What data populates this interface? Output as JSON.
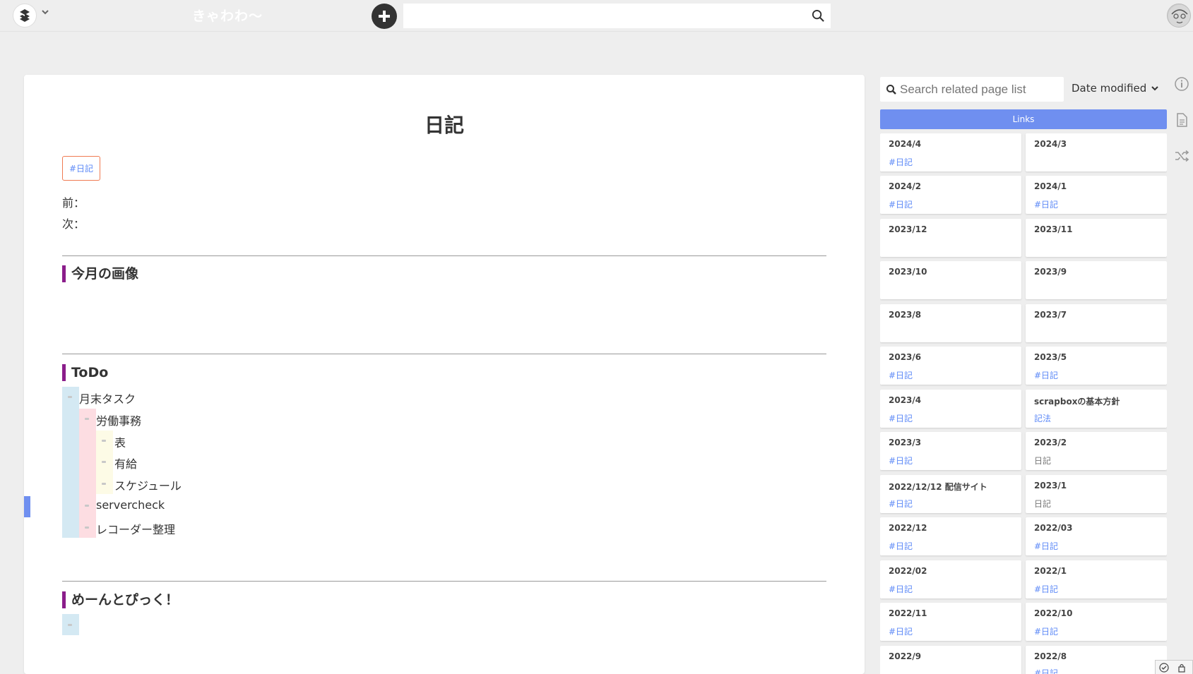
{
  "navbar": {
    "project_title": "きゃわわ〜",
    "search_value": "",
    "search_placeholder": ""
  },
  "page": {
    "title": "日記",
    "tag": "#日記",
    "prev_label": "前：",
    "next_label": "次：",
    "sections": {
      "images": {
        "heading": "今月の画像"
      },
      "todo": {
        "heading": "ToDo",
        "items": [
          {
            "text": "月末タスク",
            "level": 1
          },
          {
            "text": "労働事務",
            "level": 2
          },
          {
            "text": "表",
            "level": 3
          },
          {
            "text": "有給",
            "level": 3
          },
          {
            "text": "スケジュール",
            "level": 3
          },
          {
            "text": "servercheck",
            "level": 2
          },
          {
            "text": "レコーダー整理",
            "level": 2
          }
        ]
      },
      "mention": {
        "heading": "めーんとぴっく！"
      }
    }
  },
  "related": {
    "search_placeholder": "Search related page list",
    "sort_label": "Date modified",
    "links_label": "Links",
    "cards": [
      {
        "title": "2024/4",
        "desc": "#日記",
        "desc_style": "link"
      },
      {
        "title": "2024/3",
        "desc": "",
        "desc_style": "link"
      },
      {
        "title": "2024/2",
        "desc": "#日記",
        "desc_style": "link"
      },
      {
        "title": "2024/1",
        "desc": "#日記",
        "desc_style": "link"
      },
      {
        "title": "2023/12",
        "desc": "",
        "desc_style": "link"
      },
      {
        "title": "2023/11",
        "desc": "",
        "desc_style": "link"
      },
      {
        "title": "2023/10",
        "desc": "",
        "desc_style": "link"
      },
      {
        "title": "2023/9",
        "desc": "",
        "desc_style": "link"
      },
      {
        "title": "2023/8",
        "desc": "",
        "desc_style": "link"
      },
      {
        "title": "2023/7",
        "desc": "",
        "desc_style": "link"
      },
      {
        "title": "2023/6",
        "desc": "#日記",
        "desc_style": "link"
      },
      {
        "title": "2023/5",
        "desc": "#日記",
        "desc_style": "link"
      },
      {
        "title": "2023/4",
        "desc": "#日記",
        "desc_style": "link"
      },
      {
        "title": "scrapboxの基本方針",
        "desc": "記法",
        "desc_style": "link"
      },
      {
        "title": "2023/3",
        "desc": "#日記",
        "desc_style": "link"
      },
      {
        "title": "2023/2",
        "desc": "日記",
        "desc_style": "plain"
      },
      {
        "title": "2022/12/12 配信サイト",
        "desc": "#日記",
        "desc_style": "link"
      },
      {
        "title": "2023/1",
        "desc": "日記",
        "desc_style": "plain"
      },
      {
        "title": "2022/12",
        "desc": "#日記",
        "desc_style": "link"
      },
      {
        "title": "2022/03",
        "desc": "#日記",
        "desc_style": "link"
      },
      {
        "title": "2022/02",
        "desc": "#日記",
        "desc_style": "link"
      },
      {
        "title": "2022/1",
        "desc": "#日記",
        "desc_style": "link"
      },
      {
        "title": "2022/11",
        "desc": "#日記",
        "desc_style": "link"
      },
      {
        "title": "2022/10",
        "desc": "#日記",
        "desc_style": "link"
      },
      {
        "title": "2022/9",
        "desc": "",
        "desc_style": "link"
      },
      {
        "title": "2022/8",
        "desc": "#日記",
        "desc_style": "link"
      }
    ]
  },
  "colors": {
    "accent": "#6f8ff0",
    "heading_bar": "#8b1d8b",
    "link": "#5e8af7",
    "tag_border": "#f07b52",
    "indent_level1": "#d4e9f3",
    "indent_level2": "#fddde2",
    "indent_level3": "#fdfbe6"
  }
}
